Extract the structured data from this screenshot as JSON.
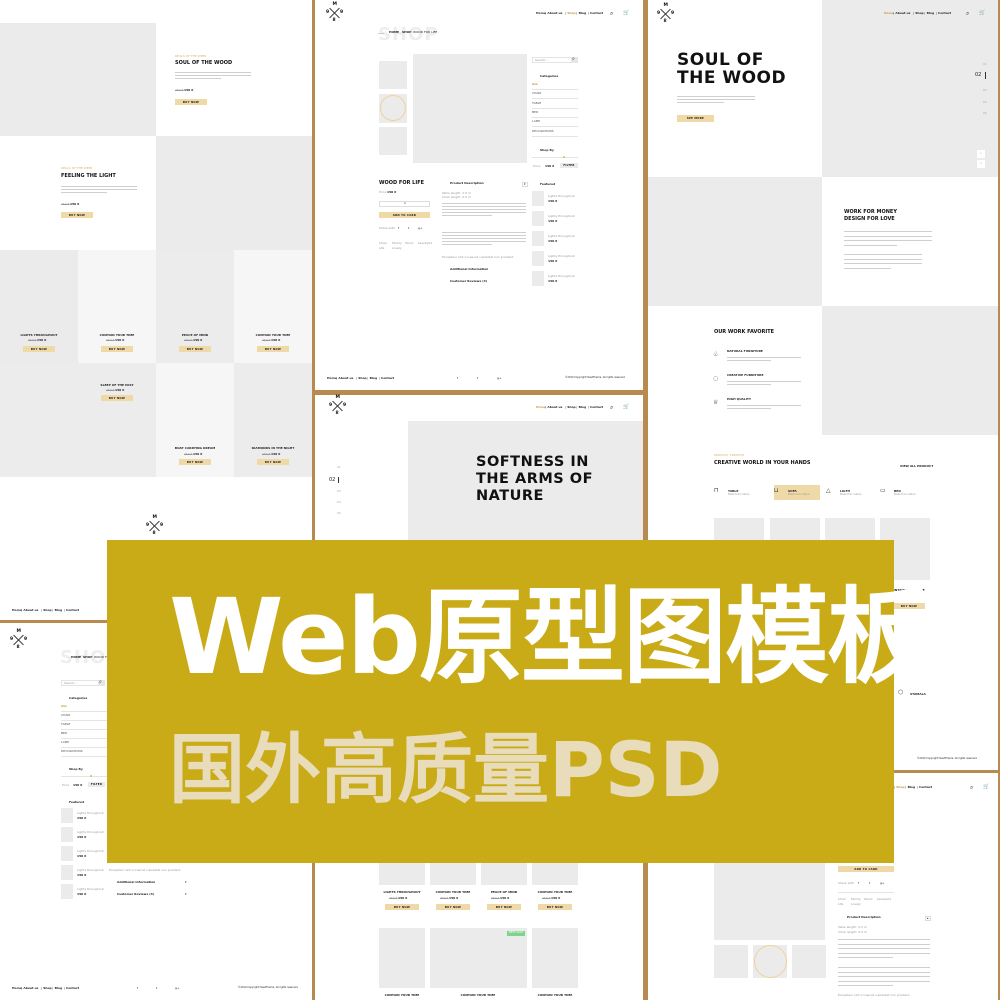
{
  "colors": {
    "accent": "#EFD9A7",
    "gold_text": "#D9B268",
    "panel_border": "#B98A4F",
    "banner": "#C9AB17",
    "banner_subtitle": "#E8DCBA",
    "placeholder": "#EBEBEB",
    "badge": "#7ED48A"
  },
  "banner": {
    "title": "Web原型图模板",
    "subtitle": "国外高质量PSD"
  },
  "logo": {
    "top": "M",
    "left": "9",
    "right": "9",
    "bottom": "8"
  },
  "nav": {
    "items": [
      "Home",
      "About us",
      "Shop",
      "Blog",
      "Contact"
    ],
    "separator": "|",
    "search_icon": "search-icon",
    "cart_icon": "cart-icon"
  },
  "price": {
    "old": "250 €",
    "new": "150 €"
  },
  "buttons": {
    "buy_now": "BUY NOW",
    "see_more": "SEE MORE",
    "add_to_card": "ADD TO CARD",
    "filter": "FILTER"
  },
  "deals": {
    "eyebrow": "DEALS OF THE WEEK",
    "items": [
      {
        "title": "SOUL OF THE WOOD"
      },
      {
        "title": "FEELING THE LIGHT"
      }
    ],
    "grid": [
      "LIGHTS THROUGHOUT",
      "CONTAIN YOUR TIME",
      "PEACE OF MIND",
      "CONTAIN YOUR TIME",
      "SLEEP OF THE PAST",
      "BOAT CARRYING DREAM",
      "DIAMONDS IN THE NIGHT"
    ]
  },
  "footer": {
    "copyright": "©2019 Copyright HeadTheme. All rights reserved.",
    "social": [
      "f",
      "t",
      "g+"
    ]
  },
  "shop": {
    "ghost_title": "SHOP",
    "breadcrumb": [
      "HOME",
      "SHOP",
      "WOOD FOR LIFE"
    ],
    "search_placeholder": "Search...",
    "categories_title": "Categories",
    "categories": [
      "ALL",
      "CHAIR",
      "TABLE",
      "BED",
      "LAMP",
      "DECORATIONS"
    ],
    "shop_by": "Shop By",
    "price_label": "Price",
    "featured_title": "Featured",
    "featured_item": "Lights throughout",
    "product_title": "WOOD FOR LIFE",
    "quantity": "1",
    "share_label": "Share with",
    "tags": [
      "Chair",
      "Family",
      "Wood",
      "beautyful",
      "Life",
      "Lovely"
    ],
    "description_title": "Product Description",
    "specs": [
      "Table length: 2.5 m",
      "Chair length: 0.5 m"
    ],
    "closing_line": "Excepteur sint occaecat cupidatat non proident.",
    "additional_info": "Additional Information",
    "reviews": "Customer Reviews (3)"
  },
  "home": {
    "hero_title": [
      "SOUL OF",
      "THE WOOD"
    ],
    "slides": [
      "01",
      "02",
      "03",
      "04",
      "05"
    ],
    "active_slide": "02",
    "work_title": [
      "WORK FOR MONEY",
      "DESIGN FOR LOVE"
    ],
    "favorite_title": "OUR WORK FAVORITE",
    "favorites": [
      {
        "title": "NATURAL FURNITURE",
        "icon": "tree-icon"
      },
      {
        "title": "CREATIVE FURNITURE",
        "icon": "bulb-icon"
      },
      {
        "title": "HIGH QUALITY",
        "icon": "trophy-icon"
      }
    ],
    "product_eyebrow": "PRODUCT CREATIVE",
    "product_title": "CREATIVE WORLD IN YOUR HANDS",
    "view_all": "VIEW ALL PRODUCT",
    "product_categories": [
      {
        "label": "TABLE",
        "sub": "Made from nature",
        "active": false
      },
      {
        "label": "SOFA",
        "sub": "Made from nature",
        "active": true
      },
      {
        "label": "LIGTH",
        "sub": "Made from nature",
        "active": false
      },
      {
        "label": "BED",
        "sub": "Made from nature",
        "active": false
      }
    ],
    "visible_product": "CONTAIN YOUR TIME",
    "partner": "STAMALA"
  },
  "softness": {
    "hero_title": [
      "SOFTNESS IN",
      "THE ARMS OF",
      "NATURE"
    ],
    "grid_row1": [
      "LIGHTS THROUGHOUT",
      "CONTAIN YOUR TIME",
      "PEACE OF MIND",
      "CONTAIN YOUR TIME"
    ],
    "grid_row2": [
      "CONTAIN YOUR TIME",
      "CONTAIN YOUR TIME",
      "CONTAIN YOUR TIME"
    ],
    "badge": "BEST SALE"
  }
}
